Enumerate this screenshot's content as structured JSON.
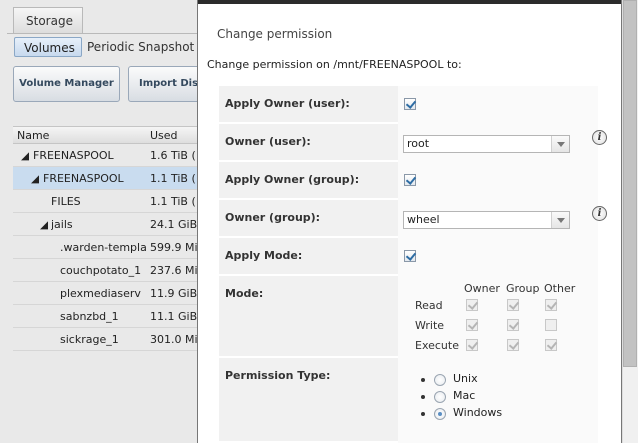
{
  "background": {
    "top_tab": "Storage",
    "subtabs": [
      "Volumes",
      "Periodic Snapshot T"
    ],
    "toolbar": [
      "Volume Manager",
      "Import Disk"
    ],
    "columns": [
      "Name",
      "Used"
    ],
    "rows": [
      {
        "name": "FREENASPOOL",
        "used": "1.6 TiB ("
      },
      {
        "name": "FREENASPOOL",
        "used": "1.1 TiB ("
      },
      {
        "name": "FILES",
        "used": "1.1 TiB ("
      },
      {
        "name": "jails",
        "used": "24.1 GiB"
      },
      {
        "name": ".warden-templa",
        "used": "599.9 Mi"
      },
      {
        "name": "couchpotato_1",
        "used": "237.6 Mi"
      },
      {
        "name": "plexmediaserv",
        "used": "11.9 GiB"
      },
      {
        "name": "sabnzbd_1",
        "used": "11.1 GiB"
      },
      {
        "name": "sickrage_1",
        "used": "301.0 Mi"
      }
    ]
  },
  "dialog": {
    "title": "Change permission",
    "description": "Change permission on /mnt/FREENASPOOL to:",
    "apply_owner_user_label": "Apply Owner (user):",
    "apply_owner_user_checked": true,
    "owner_user_label": "Owner (user):",
    "owner_user_value": "root",
    "apply_owner_group_label": "Apply Owner (group):",
    "apply_owner_group_checked": true,
    "owner_group_label": "Owner (group):",
    "owner_group_value": "wheel",
    "apply_mode_label": "Apply Mode:",
    "apply_mode_checked": true,
    "mode_label": "Mode:",
    "mode_columns": [
      "Owner",
      "Group",
      "Other"
    ],
    "mode_rows": [
      {
        "label": "Read",
        "owner": true,
        "group": true,
        "other": true
      },
      {
        "label": "Write",
        "owner": true,
        "group": true,
        "other": false
      },
      {
        "label": "Execute",
        "owner": true,
        "group": true,
        "other": true
      }
    ],
    "permission_type_label": "Permission Type:",
    "permission_types": [
      "Unix",
      "Mac",
      "Windows"
    ],
    "permission_type_selected": "Windows",
    "info_icon_glyph": "i"
  }
}
